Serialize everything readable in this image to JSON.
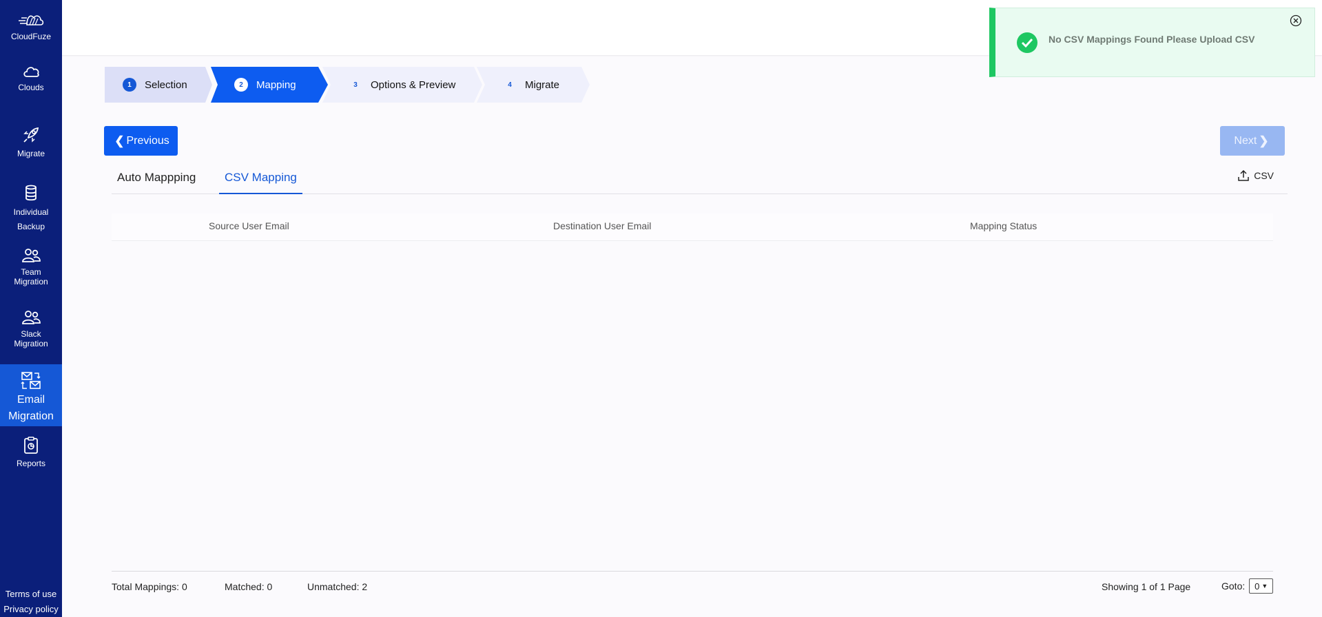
{
  "sidebar": {
    "logo_text": "CloudFuze",
    "items": [
      {
        "label": "Clouds",
        "icon": "cloud-icon"
      },
      {
        "label": "Migrate",
        "icon": "rocket-icon"
      },
      {
        "label": "Individual\nBackup",
        "icon": "database-icon"
      },
      {
        "label": "Team\nMigration",
        "icon": "team-icon"
      },
      {
        "label": "Slack\nMigration",
        "icon": "slack-team-icon"
      },
      {
        "label": "Email\nMigration",
        "icon": "email-migration-icon"
      },
      {
        "label": "Reports",
        "icon": "reports-icon"
      }
    ],
    "terms": "Terms of use",
    "privacy": "Privacy policy"
  },
  "stepper": {
    "steps": [
      {
        "num": "1",
        "label": "Selection"
      },
      {
        "num": "2",
        "label": "Mapping"
      },
      {
        "num": "3",
        "label": "Options & Preview"
      },
      {
        "num": "4",
        "label": "Migrate"
      }
    ]
  },
  "buttons": {
    "previous": "Previous",
    "next": "Next"
  },
  "tabs": {
    "auto": "Auto Mappping",
    "csv": "CSV Mapping",
    "csv_upload": "CSV"
  },
  "table": {
    "columns": [
      "Source User Email",
      "Destination User Email",
      "Mapping Status"
    ],
    "rows": []
  },
  "footer": {
    "total": "Total Mappings: 0",
    "matched": "Matched: 0",
    "unmatched": "Unmatched: 2",
    "showing": "Showing 1 of 1 Page",
    "goto_label": "Goto:",
    "goto_value": "0"
  },
  "toast": {
    "message": "No CSV Mappings Found Please Upload CSV"
  },
  "colors": {
    "sidebar_bg": "#0b1f7a",
    "primary": "#0d5cf0",
    "toast_accent": "#1ec762"
  }
}
